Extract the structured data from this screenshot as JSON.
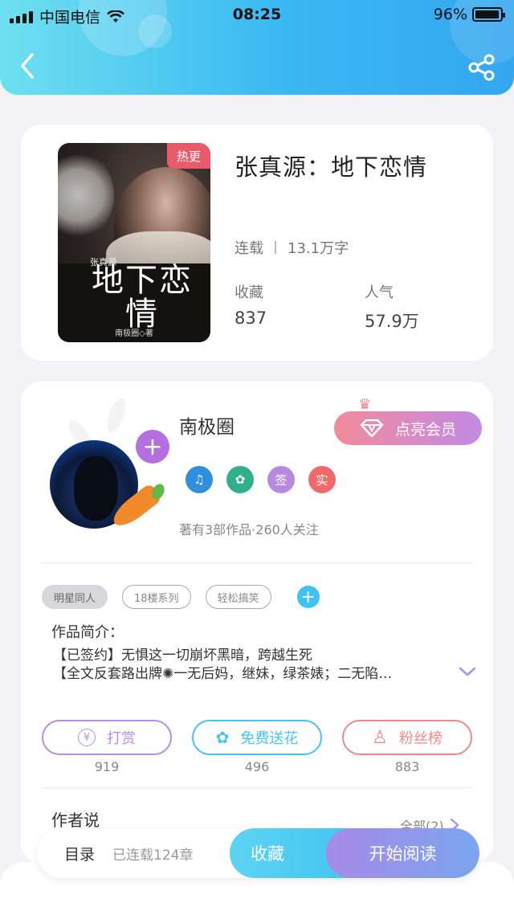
{
  "status_bar": {
    "carrier": "中国电信",
    "time": "08:25",
    "battery": "96%",
    "battery_level": 0.96
  },
  "book": {
    "title": "张真源：地下恋情",
    "badge": "热更",
    "cover": {
      "small_text": "张真源",
      "title": "地下恋情",
      "author_line": "南极圈◇著"
    },
    "status": "连载",
    "word_count": "13.1万字",
    "favorites_label": "收藏",
    "favorites_value": "837",
    "popularity_label": "人气",
    "popularity_value": "57.9万"
  },
  "author": {
    "name": "南极圈",
    "vip_button": "点亮会员",
    "badges": [
      "♫",
      "✿",
      "签",
      "实"
    ],
    "badge_colors": [
      "#2f8fdc",
      "#2fb08b",
      "#b68ae0",
      "#ef6b6b"
    ],
    "works_summary": "著有3部作品·260人关注"
  },
  "tags": [
    "明星同人",
    "18楼系列",
    "轻松搞笑"
  ],
  "intro": {
    "heading": "作品简介：",
    "lines": [
      "【已签约】无惧这一切崩坏黑暗，跨越生死",
      "【全文反套路出牌✺一无后妈，继妹，绿茶婊；二无陷…"
    ]
  },
  "actions": [
    {
      "label": "打赏",
      "icon": "¥",
      "count": "919",
      "color": "#b98ce6"
    },
    {
      "label": "免费送花",
      "icon": "✿",
      "count": "496",
      "color": "#45c6e8"
    },
    {
      "label": "粉丝榜",
      "icon": "♙",
      "count": "883",
      "color": "#ee8a8a"
    }
  ],
  "author_say": {
    "heading": "作者说",
    "all_link": "全部(2)"
  },
  "bottom_bar": {
    "toc": "目录",
    "chapters": "已连载124章",
    "collect": "收藏",
    "read": "开始阅读"
  }
}
